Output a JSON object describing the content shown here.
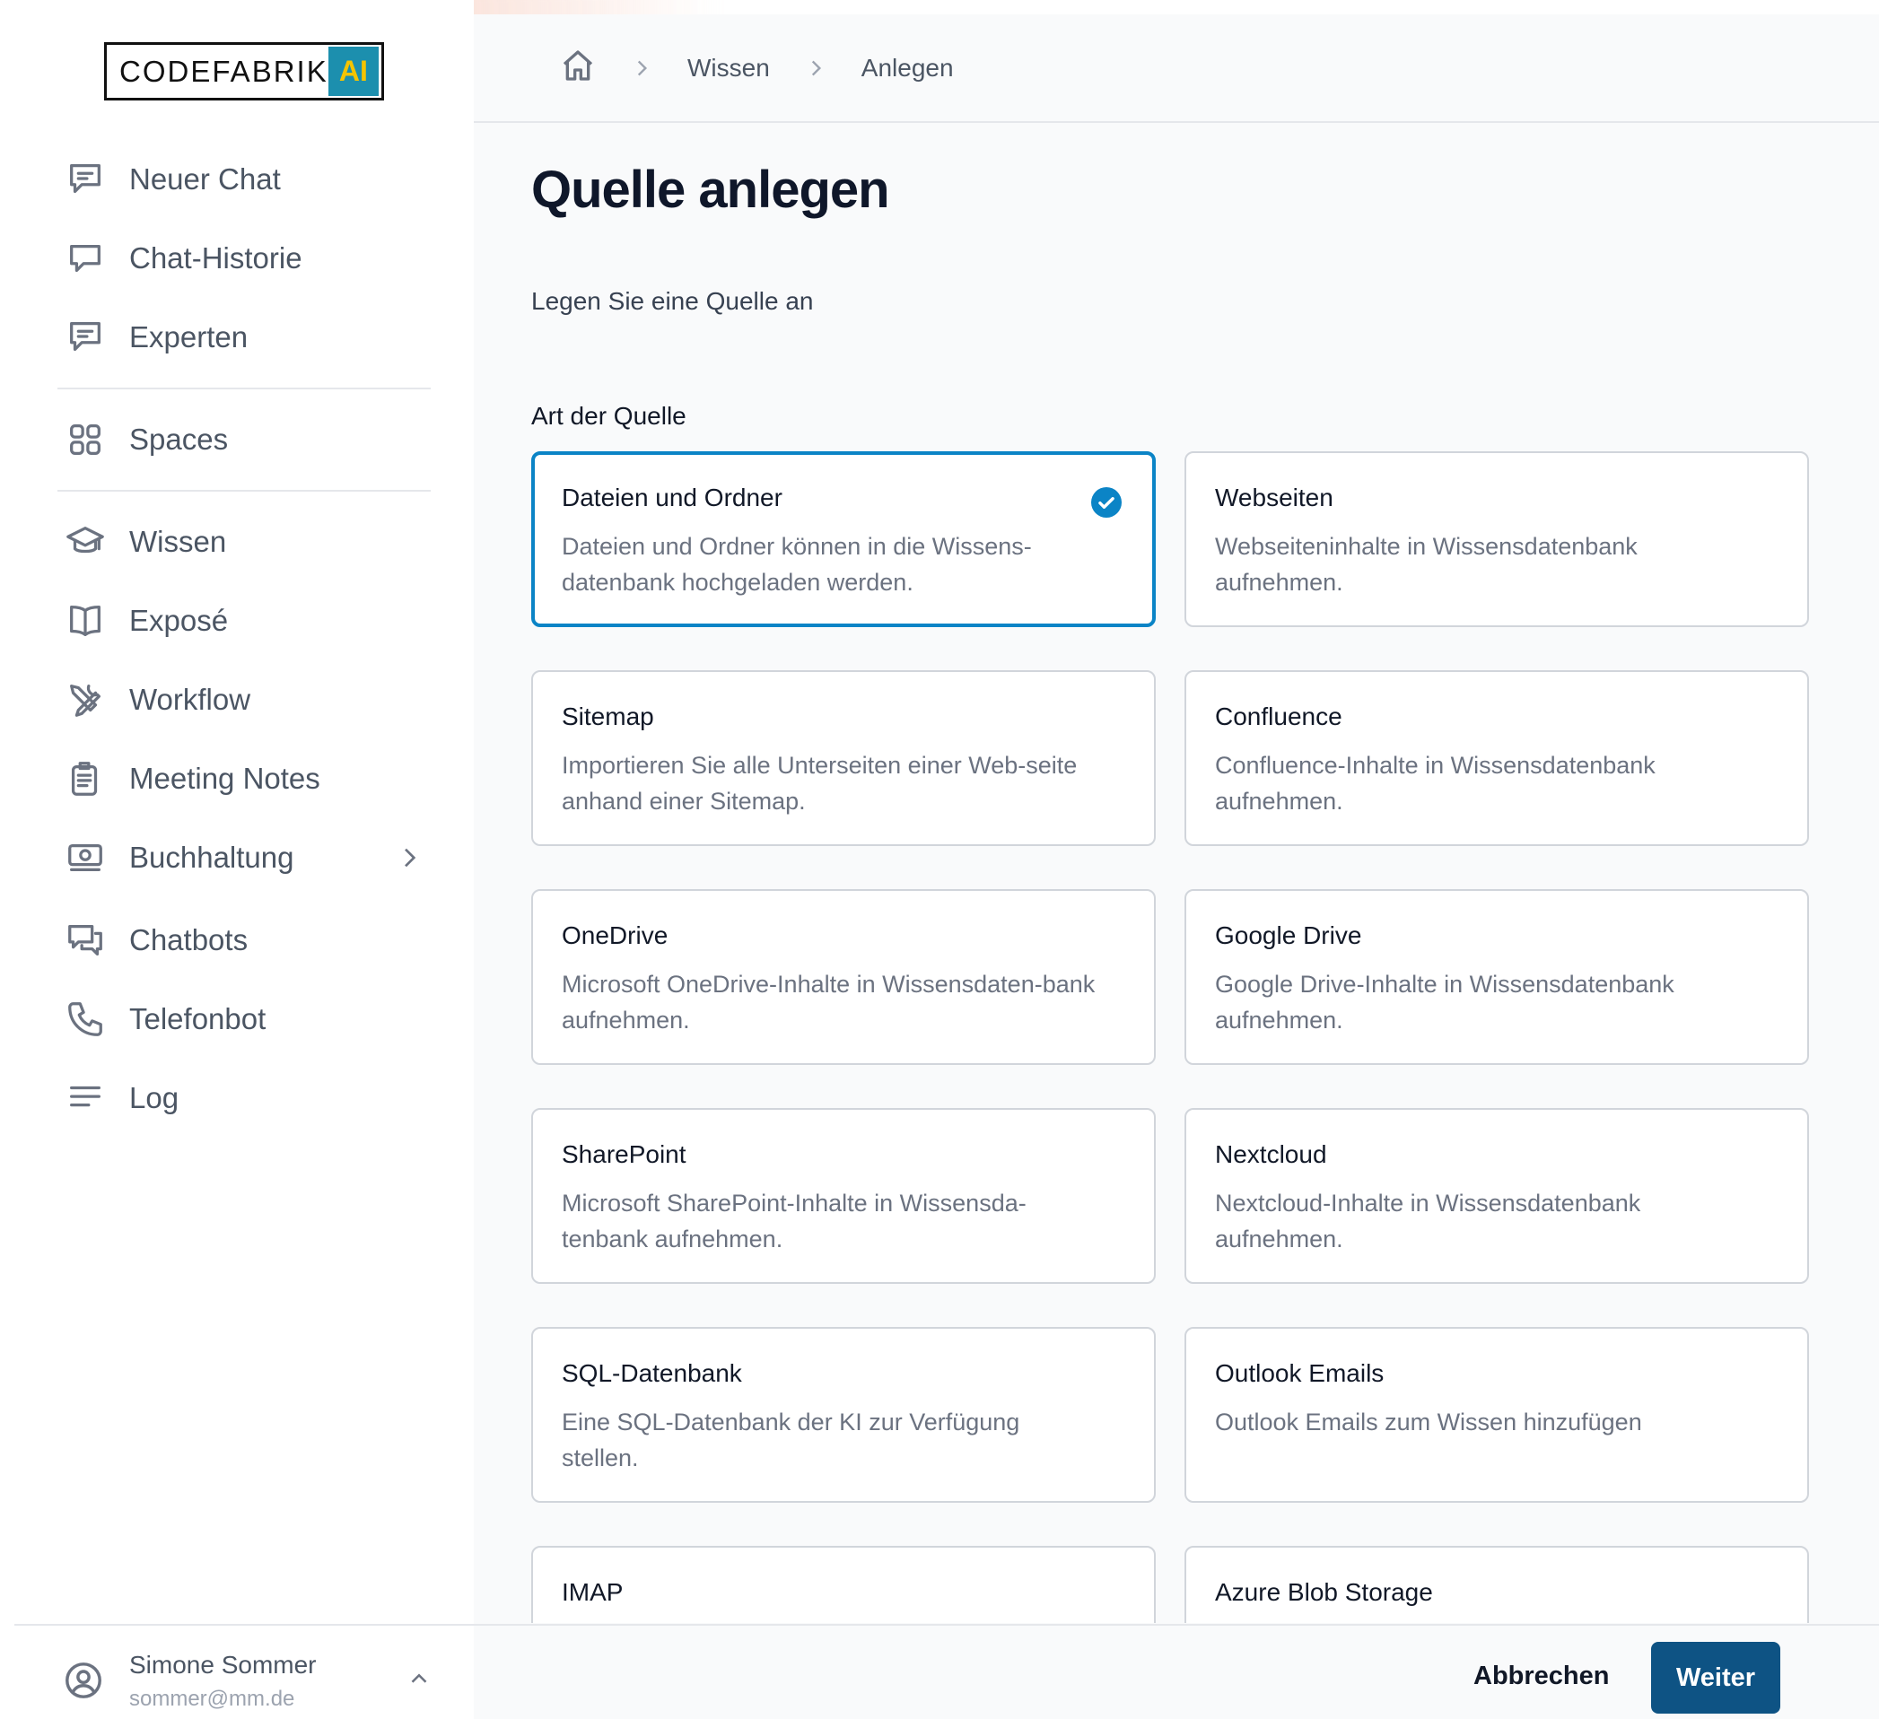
{
  "logo": {
    "text": "CODEFABRIK",
    "badge": "AI",
    "badge_color": "#1c8fae",
    "badge_text_color": "#f5c400"
  },
  "sidebar": {
    "items": [
      {
        "label": "Neuer Chat",
        "icon": "chat-bubble-text-icon"
      },
      {
        "label": "Chat-Historie",
        "icon": "chat-bubble-icon"
      },
      {
        "label": "Experten",
        "icon": "chat-bubble-text-icon"
      },
      {
        "label": "Spaces",
        "icon": "grid-icon"
      },
      {
        "label": "Wissen",
        "icon": "graduation-cap-icon"
      },
      {
        "label": "Exposé",
        "icon": "book-open-icon"
      },
      {
        "label": "Workflow",
        "icon": "tools-icon"
      },
      {
        "label": "Meeting Notes",
        "icon": "clipboard-icon"
      },
      {
        "label": "Buchhaltung",
        "icon": "banknotes-icon",
        "has_submenu": true
      },
      {
        "label": "Chatbots",
        "icon": "chat-bubbles-icon"
      },
      {
        "label": "Telefonbot",
        "icon": "phone-icon"
      },
      {
        "label": "Log",
        "icon": "lines-icon"
      }
    ]
  },
  "user": {
    "name": "Simone Sommer",
    "email": "sommer@mm.de"
  },
  "breadcrumb": {
    "items": [
      "Wissen",
      "Anlegen"
    ]
  },
  "page": {
    "title": "Quelle anlegen",
    "subtitle": "Legen Sie eine Quelle an",
    "section_label": "Art der Quelle"
  },
  "sources": [
    {
      "title": "Dateien und Ordner",
      "desc": "Dateien und Ordner können in die Wissens-datenbank hochgeladen werden.",
      "selected": true
    },
    {
      "title": "Webseiten",
      "desc": "Webseiteninhalte in Wissensdatenbank aufnehmen.",
      "selected": false
    },
    {
      "title": "Sitemap",
      "desc": "Importieren Sie alle Unterseiten einer Web-seite anhand einer Sitemap.",
      "selected": false
    },
    {
      "title": "Confluence",
      "desc": "Confluence-Inhalte in Wissensdatenbank aufnehmen.",
      "selected": false
    },
    {
      "title": "OneDrive",
      "desc": "Microsoft OneDrive-Inhalte in Wissensdaten-bank aufnehmen.",
      "selected": false
    },
    {
      "title": "Google Drive",
      "desc": "Google Drive-Inhalte in Wissensdatenbank aufnehmen.",
      "selected": false
    },
    {
      "title": "SharePoint",
      "desc": "Microsoft SharePoint-Inhalte in Wissensda-tenbank aufnehmen.",
      "selected": false
    },
    {
      "title": "Nextcloud",
      "desc": "Nextcloud-Inhalte in Wissensdatenbank aufnehmen.",
      "selected": false
    },
    {
      "title": "SQL-Datenbank",
      "desc": "Eine SQL-Datenbank der KI zur Verfügung stellen.",
      "selected": false
    },
    {
      "title": "Outlook Emails",
      "desc": "Outlook Emails zum Wissen hinzufügen",
      "selected": false
    },
    {
      "title": "IMAP",
      "desc": "",
      "selected": false
    },
    {
      "title": "Azure Blob Storage",
      "desc": "",
      "selected": false
    }
  ],
  "footer": {
    "cancel_label": "Abbrechen",
    "next_label": "Weiter"
  },
  "colors": {
    "accent": "#0b84c6",
    "primary_button": "#0e5384",
    "main_bg": "#f9fafb"
  }
}
